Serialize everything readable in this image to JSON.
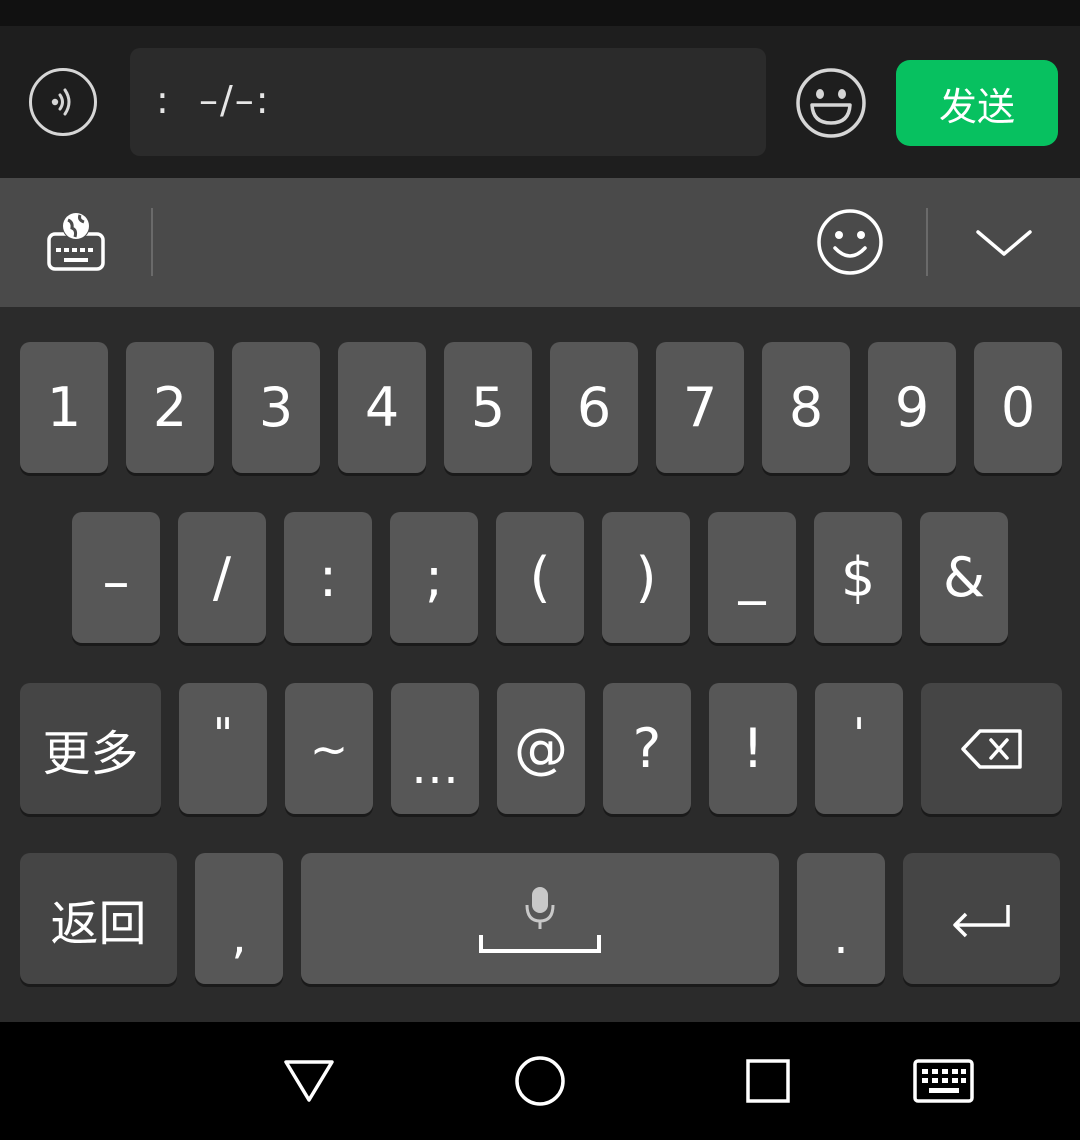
{
  "input_bar": {
    "voice_icon": "voice-mode-icon",
    "text_value": ":  –/–:",
    "emoji_icon": "emoji-grin-icon",
    "send_label": "发送",
    "send_color": "#07c160"
  },
  "toolbar": {
    "icons": [
      "keyboard-language-icon",
      "smile-icon",
      "chevron-down-icon"
    ]
  },
  "keyboard": {
    "row1": [
      "1",
      "2",
      "3",
      "4",
      "5",
      "6",
      "7",
      "8",
      "9",
      "0"
    ],
    "row2": [
      "–",
      "/",
      ":",
      ";",
      "(",
      ")",
      "_",
      "$",
      "&"
    ],
    "row3": [
      "\"",
      "~",
      "…",
      "@",
      "?",
      "!",
      "'"
    ],
    "more_label": "更多",
    "back_label": "返回",
    "comma": ",",
    "period": ".",
    "space_icon": "microphone-icon",
    "backspace_icon": "backspace-icon",
    "enter_icon": "enter-icon"
  },
  "navbar": {
    "icons": [
      "back-triangle-icon",
      "home-circle-icon",
      "recents-square-icon",
      "keyboard-toggle-icon"
    ]
  }
}
